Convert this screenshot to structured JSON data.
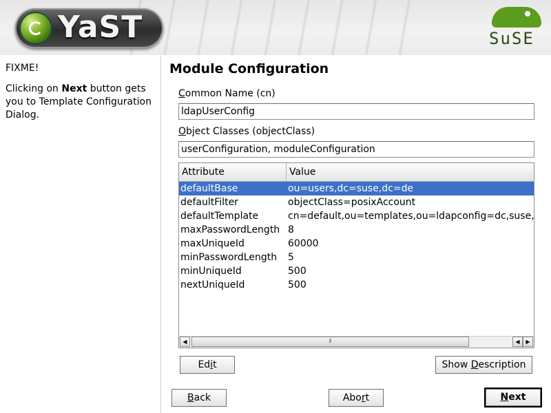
{
  "header": {
    "app_logo_text": "YaST",
    "vendor_logo_text": "SuSE"
  },
  "help": {
    "title": "FIXME!",
    "text_before": "Clicking on ",
    "text_bold": "Next",
    "text_after": " button gets you to Template Configuration Dialog."
  },
  "main": {
    "title": "Module Configuration",
    "common_name": {
      "label_mnemonic": "C",
      "label_rest": "ommon Name (cn)",
      "value": "ldapUserConfig"
    },
    "object_classes": {
      "label_mnemonic": "O",
      "label_rest": "bject Classes (objectClass)",
      "value": "userConfiguration, moduleConfiguration"
    },
    "table": {
      "columns": [
        "Attribute",
        "Value"
      ],
      "rows": [
        {
          "attribute": "defaultBase",
          "value": "ou=users,dc=suse,dc=de",
          "selected": true
        },
        {
          "attribute": "defaultFilter",
          "value": "objectClass=posixAccount",
          "selected": false
        },
        {
          "attribute": "defaultTemplate",
          "value": "cn=default,ou=templates,ou=ldapconfig=dc,suse,dc=de",
          "selected": false
        },
        {
          "attribute": "maxPasswordLength",
          "value": "8",
          "selected": false
        },
        {
          "attribute": "maxUniqueId",
          "value": "60000",
          "selected": false
        },
        {
          "attribute": "minPasswordLength",
          "value": "5",
          "selected": false
        },
        {
          "attribute": "minUniqueId",
          "value": "500",
          "selected": false
        },
        {
          "attribute": "nextUniqueId",
          "value": "500",
          "selected": false
        }
      ]
    },
    "edit_button": {
      "pre": "Ed",
      "mnemonic": "i",
      "post": "t"
    },
    "show_description_button": {
      "pre": "Show ",
      "mnemonic": "D",
      "post": "escription"
    }
  },
  "footer": {
    "back_button": {
      "pre": "",
      "mnemonic": "B",
      "post": "ack"
    },
    "abort_button": {
      "pre": "Abo",
      "mnemonic": "r",
      "post": "t"
    },
    "next_button": {
      "pre": "",
      "mnemonic": "N",
      "post": "ext"
    }
  },
  "colors": {
    "selection": "#3d70c8",
    "yast_green": "#6fa81e",
    "suse_green": "#5c9c1e"
  }
}
